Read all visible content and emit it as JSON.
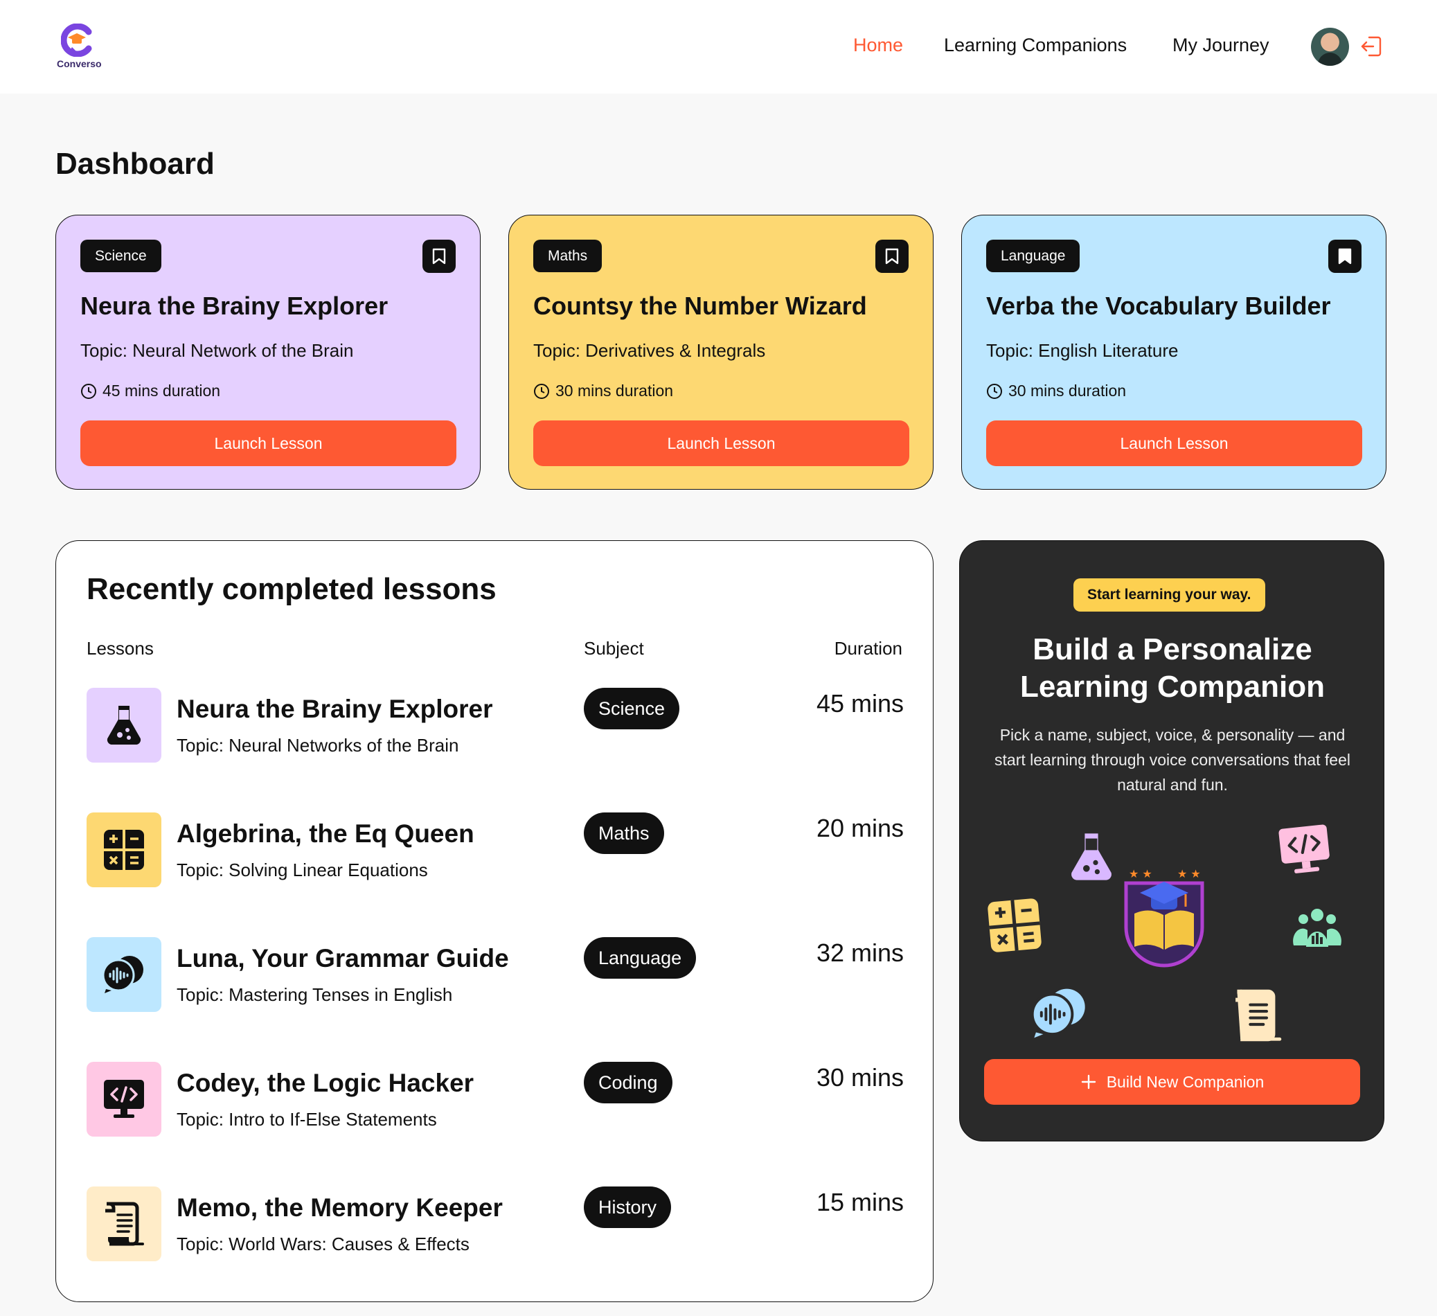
{
  "brand": {
    "name": "Converso"
  },
  "nav": {
    "home": "Home",
    "companions": "Learning Companions",
    "journey": "My Journey"
  },
  "page": {
    "title": "Dashboard"
  },
  "featured": [
    {
      "subject": "Science",
      "title": "Neura the Brainy Explorer",
      "topic": "Topic: Neural Network of the Brain",
      "duration": "45 mins duration",
      "button": "Launch Lesson",
      "color": "#e5d0ff",
      "bookmarked": false
    },
    {
      "subject": "Maths",
      "title": "Countsy the Number Wizard",
      "topic": "Topic: Derivatives & Integrals",
      "duration": "30 mins duration",
      "button": "Launch Lesson",
      "color": "#fdd872",
      "bookmarked": false
    },
    {
      "subject": "Language",
      "title": "Verba the Vocabulary Builder",
      "topic": "Topic: English Literature",
      "duration": "30 mins duration",
      "button": "Launch Lesson",
      "color": "#bde7ff",
      "bookmarked": true
    }
  ],
  "recent": {
    "title": "Recently completed lessons",
    "headers": {
      "lessons": "Lessons",
      "subject": "Subject",
      "duration": "Duration"
    },
    "rows": [
      {
        "icon": "flask-icon",
        "title": "Neura the Brainy Explorer",
        "topic": "Topic: Neural Networks of the Brain",
        "subject": "Science",
        "duration": "45 mins",
        "color": "#e5d0ff"
      },
      {
        "icon": "calculator-icon",
        "title": "Algebrina, the Eq Queen",
        "topic": "Topic: Solving Linear Equations",
        "subject": "Maths",
        "duration": "20 mins",
        "color": "#fdd872"
      },
      {
        "icon": "chat-bubbles-icon",
        "title": "Luna, Your Grammar Guide",
        "topic": "Topic: Mastering Tenses in English",
        "subject": "Language",
        "duration": "32 mins",
        "color": "#bde7ff"
      },
      {
        "icon": "code-monitor-icon",
        "title": "Codey, the Logic Hacker",
        "topic": "Topic: Intro to If-Else Statements",
        "subject": "Coding",
        "duration": "30 mins",
        "color": "#ffc8e4"
      },
      {
        "icon": "scroll-icon",
        "title": "Memo, the Memory Keeper",
        "topic": "Topic: World Wars: Causes & Effects",
        "subject": "History",
        "duration": "15 mins",
        "color": "#ffecc8"
      }
    ]
  },
  "cta": {
    "chip": "Start learning your way.",
    "title_line1": "Build a Personalize",
    "title_line2": "Learning Companion",
    "description": "Pick a name, subject, voice, & personality — and start learning through voice conversations that feel natural and fun.",
    "button": "Build New Companion"
  },
  "colors": {
    "accent": "#fe5933",
    "dark": "#111111",
    "panel": "#2a2a2a",
    "chip": "#fdd050"
  }
}
